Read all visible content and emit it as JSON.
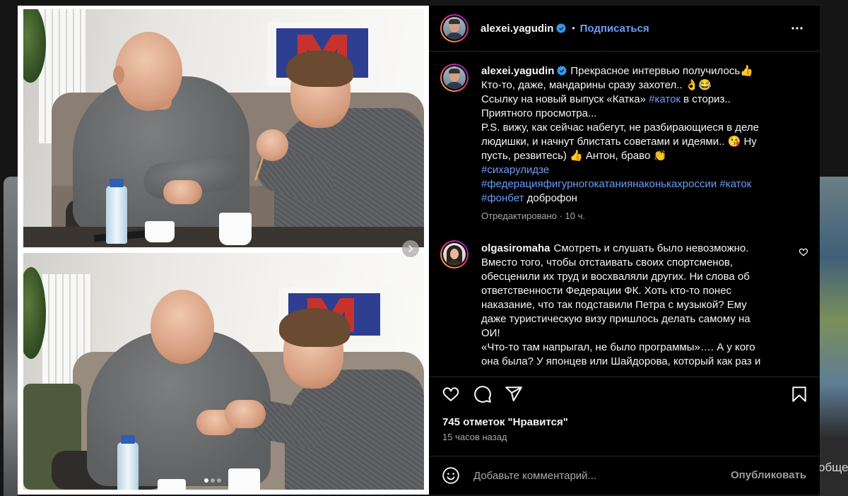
{
  "backdrop": {
    "edge_text": "обще"
  },
  "media": {
    "slide_count": 3,
    "active_slide": 1,
    "next_icon": "chevron-right-icon"
  },
  "header": {
    "username": "alexei.yagudin",
    "verified_icon": "verified-badge-icon",
    "separator": "•",
    "follow_label": "Подписаться",
    "more_icon": "more-horizontal-icon"
  },
  "caption": {
    "username": "alexei.yagudin",
    "lines": [
      [
        "Прекрасное интервью получилось👍"
      ],
      [
        "Кто-то, даже, мандарины сразу захотел.. 👌😂"
      ],
      [
        "Ссылку на новый выпуск «Катка» ",
        "#каток",
        " в сториз.."
      ],
      [
        "Приятного просмотра..."
      ],
      [
        "P.S. вижу, как сейчас набегут, не разбирающиеся в деле"
      ],
      [
        "людишки, и начнут блистать советами и идеями.. 😘 Ну"
      ],
      [
        "пусть, резвитесь) 👍 Антон, браво 👏"
      ],
      [
        "#сихарулидзе"
      ],
      [
        "#федерацияфигурногокатаниянаконькахроссии #каток"
      ],
      [
        "#фонбет",
        " доброфон"
      ]
    ],
    "meta": "Отредактировано · 10 ч."
  },
  "comment": {
    "username": "olgasiromaha",
    "lines": [
      "Смотреть и слушать было невозможно.",
      "Вместо того, чтобы отстаивать своих спортсменов,",
      "обесценили их труд и восхваляли других. Ни слова об",
      "ответственности Федерации ФК. Хоть кто-то понес",
      "наказание, что так подставили Петра с музыкой? Ему",
      "даже туристическую визу пришлось делать самому на",
      "ОИ!",
      "«Что-то там напрыгал, не было программы»…. А у кого",
      "она была? У японцев или Шайдорова, который как раз и"
    ],
    "like_icon": "heart-outline-icon"
  },
  "actions": {
    "like_icon": "heart-outline-icon",
    "comment_icon": "comment-bubble-icon",
    "share_icon": "paper-plane-icon",
    "save_icon": "bookmark-icon"
  },
  "likes_label": "745 отметок \"Нравится\"",
  "posted_ago": "15 часов назад",
  "comment_input": {
    "emoji_icon": "smiley-icon",
    "placeholder": "Добавьте комментарий...",
    "publish_label": "Опубликовать"
  },
  "colors": {
    "panel_background": "#000000",
    "link_blue": "#6e9cf5",
    "muted_text": "#a8a8a8",
    "divider": "#262626",
    "verified_blue": "#3897f0"
  }
}
